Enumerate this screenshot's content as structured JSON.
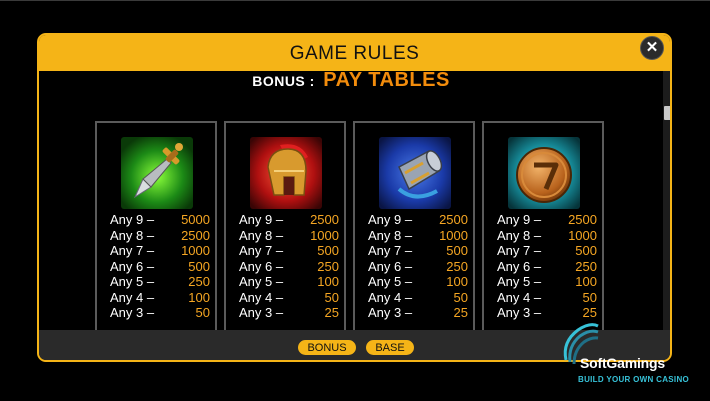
{
  "window": {
    "title": "GAME RULES",
    "close_label": "✕"
  },
  "section": {
    "label": "BONUS :",
    "title": "PAY TABLES"
  },
  "cards": [
    {
      "icon": "sword-icon",
      "rows": [
        {
          "label": "Any 9 –",
          "value": "5000"
        },
        {
          "label": "Any 8 –",
          "value": "2500"
        },
        {
          "label": "Any 7 –",
          "value": "1000"
        },
        {
          "label": "Any 6 –",
          "value": "500"
        },
        {
          "label": "Any 5 –",
          "value": "250"
        },
        {
          "label": "Any 4 –",
          "value": "100"
        },
        {
          "label": "Any 3 –",
          "value": "50"
        }
      ]
    },
    {
      "icon": "spartan-helmet-icon",
      "rows": [
        {
          "label": "Any 9 –",
          "value": "2500"
        },
        {
          "label": "Any 8 –",
          "value": "1000"
        },
        {
          "label": "Any 7 –",
          "value": "500"
        },
        {
          "label": "Any 6 –",
          "value": "250"
        },
        {
          "label": "Any 5 –",
          "value": "100"
        },
        {
          "label": "Any 4 –",
          "value": "50"
        },
        {
          "label": "Any 3 –",
          "value": "25"
        }
      ]
    },
    {
      "icon": "vambrace-icon",
      "rows": [
        {
          "label": "Any 9 –",
          "value": "2500"
        },
        {
          "label": "Any 8 –",
          "value": "1000"
        },
        {
          "label": "Any 7 –",
          "value": "500"
        },
        {
          "label": "Any 6 –",
          "value": "250"
        },
        {
          "label": "Any 5 –",
          "value": "100"
        },
        {
          "label": "Any 4 –",
          "value": "50"
        },
        {
          "label": "Any 3 –",
          "value": "25"
        }
      ]
    },
    {
      "icon": "shield-icon",
      "rows": [
        {
          "label": "Any 9 –",
          "value": "2500"
        },
        {
          "label": "Any 8 –",
          "value": "1000"
        },
        {
          "label": "Any 7 –",
          "value": "500"
        },
        {
          "label": "Any 6 –",
          "value": "250"
        },
        {
          "label": "Any 5 –",
          "value": "100"
        },
        {
          "label": "Any 4 –",
          "value": "50"
        },
        {
          "label": "Any 3 –",
          "value": "25"
        }
      ]
    }
  ],
  "tabs": [
    {
      "label": "BONUS"
    },
    {
      "label": "BASE"
    }
  ],
  "watermark": {
    "name": "SoftGamings",
    "tagline": "BUILD YOUR OWN CASINO"
  },
  "colors": {
    "accent": "#f5b417",
    "value": "#f5a623",
    "title_orange": "#f28c0c",
    "watermark_teal": "#37c2d8"
  }
}
